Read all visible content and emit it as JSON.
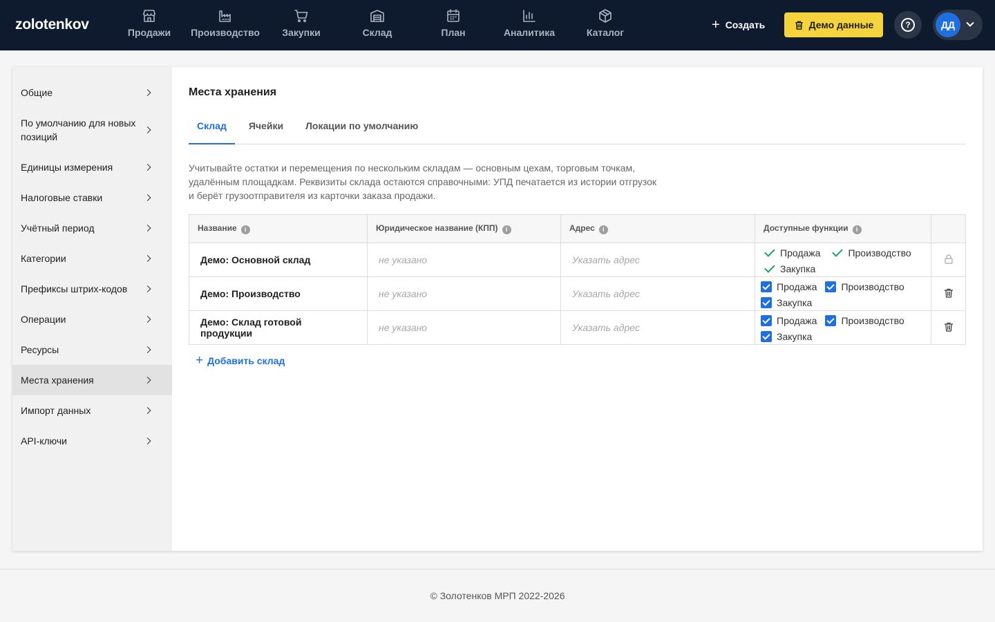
{
  "brand": {
    "logo": "zolotenkov"
  },
  "nav": [
    {
      "label": "Продажи",
      "icon": "store-icon"
    },
    {
      "label": "Производство",
      "icon": "factory-icon"
    },
    {
      "label": "Закупки",
      "icon": "cart-icon"
    },
    {
      "label": "Склад",
      "icon": "warehouse-icon"
    },
    {
      "label": "План",
      "icon": "calendar-icon"
    },
    {
      "label": "Аналитика",
      "icon": "bar-chart-icon"
    },
    {
      "label": "Каталог",
      "icon": "box-icon"
    }
  ],
  "header": {
    "create_label": "Создать",
    "demo_label": "Демо данные",
    "help_icon": "help-circle-icon",
    "avatar_initials": "ДД"
  },
  "sidebar": {
    "items": [
      {
        "label": "Общие"
      },
      {
        "label": "По умолчанию для новых позиций"
      },
      {
        "label": "Единицы измерения"
      },
      {
        "label": "Налоговые ставки"
      },
      {
        "label": "Учётный период"
      },
      {
        "label": "Категории"
      },
      {
        "label": "Префиксы штрих-кодов"
      },
      {
        "label": "Операции"
      },
      {
        "label": "Ресурсы"
      },
      {
        "label": "Места хранения",
        "active": true
      },
      {
        "label": "Импорт данных"
      },
      {
        "label": "API-ключи"
      }
    ]
  },
  "main": {
    "title": "Места хранения",
    "tabs": [
      {
        "label": "Склад",
        "active": true
      },
      {
        "label": "Ячейки"
      },
      {
        "label": "Локации по умолчанию"
      }
    ],
    "description": "Учитывайте остатки и перемещения по нескольким складам — основным цехам, торговым точкам, удалённым площадкам. Реквизиты склада остаются справочными: УПД печатается из истории отгрузок и берёт грузоотправителя из карточки заказа продажи.",
    "table": {
      "columns": [
        "Название",
        "Юридическое название (КПП)",
        "Адрес",
        "Доступные функции"
      ],
      "rows": [
        {
          "name": "Демо: Основной склад",
          "legal": "не указано",
          "address": "Указать адрес",
          "functions": [
            "Продажа",
            "Производство",
            "Закупка"
          ],
          "locked": true
        },
        {
          "name": "Демо: Производство",
          "legal": "не указано",
          "address": "Указать адрес",
          "functions": [
            "Продажа",
            "Производство",
            "Закупка"
          ],
          "locked": false
        },
        {
          "name": "Демо: Склад готовой продукции",
          "legal": "не указано",
          "address": "Указать адрес",
          "functions": [
            "Продажа",
            "Производство",
            "Закупка"
          ],
          "locked": false
        }
      ]
    },
    "add_label": "Добавить склад"
  },
  "footer": {
    "text": "© Золотенков МРП 2022-2026"
  },
  "colors": {
    "topbar": "#0e1b2e",
    "accent": "#1f6fe0",
    "demo_button": "#f5d33d",
    "check": "#18a06a"
  }
}
